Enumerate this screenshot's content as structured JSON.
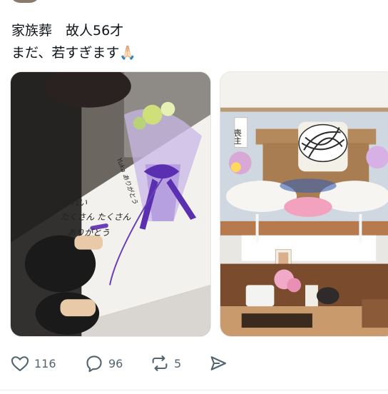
{
  "post": {
    "text_line1": "家族葬　故人56才",
    "text_line2": "まだ、若すぎます🙏🏻"
  },
  "media": {
    "image1_writing": [
      "きれい",
      "たくさん たくさん",
      "ありがとう"
    ],
    "image1_writing_small": "Yuka ありがとう",
    "image2_sign": "喪主"
  },
  "actions": {
    "like_count": "116",
    "reply_count": "96",
    "repost_count": "5"
  },
  "colors": {
    "accent_purple": "#7b57c9",
    "icon_gray": "#536471",
    "text": "#0f1419"
  },
  "icons": {
    "like": "heart-outline-icon",
    "reply": "speech-bubble-icon",
    "repost": "repost-arrows-icon",
    "share": "paper-plane-icon"
  }
}
